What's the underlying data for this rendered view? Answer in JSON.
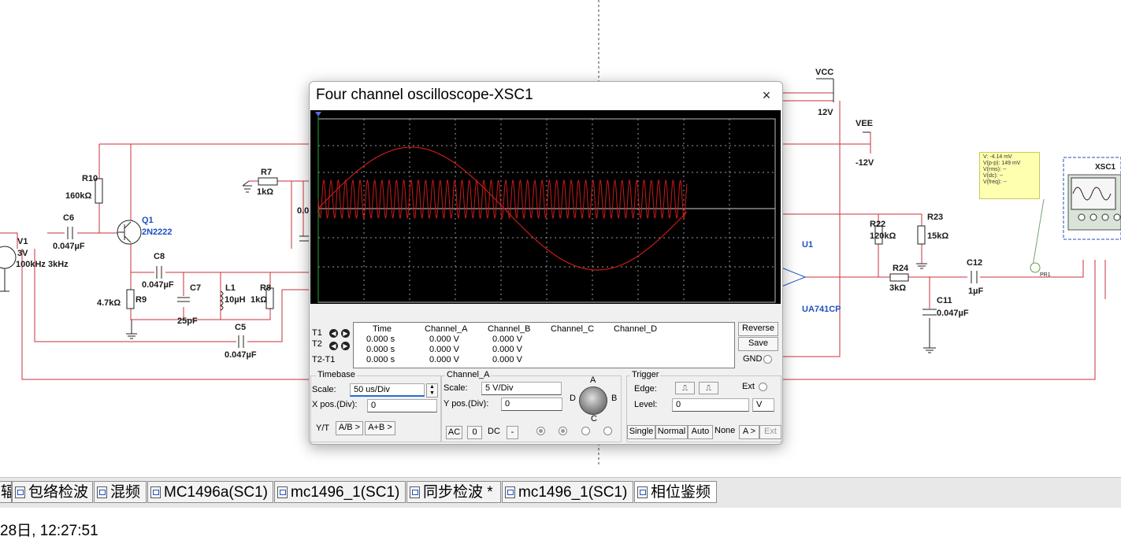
{
  "schematic": {
    "components": {
      "r10": "R10",
      "r10_val": "160kΩ",
      "c6": "C6",
      "c6_val": "0.047µF",
      "v1": "V1",
      "v1_val1": "3V",
      "v1_val2": "100kHz 3kHz",
      "q1": "Q1",
      "q1_val": "2N2222",
      "r7": "R7",
      "r7_val": "1kΩ",
      "c8": "C8",
      "c8_val": "0.047µF",
      "c7": "C7",
      "c7_val": "25pF",
      "l1": "L1",
      "l1_val": "10µH",
      "r8": "R8",
      "r8_val": "1kΩ",
      "r9": "R9",
      "r9_val": "4.7kΩ",
      "c5": "C5",
      "c5_val": "0.047µF",
      "partial_val": "0.0",
      "vcc": "VCC",
      "vcc_val": "12V",
      "vee": "VEE",
      "vee_val": "-12V",
      "u1": "U1",
      "u1_val": "UA741CP",
      "r22": "R22",
      "r22_val": "120kΩ",
      "r23": "R23",
      "r23_val": "15kΩ",
      "r24": "R24",
      "r24_val": "3kΩ",
      "c12": "C12",
      "c12_val": "1µF",
      "c11": "C11",
      "c11_val": "0.047µF",
      "pr1": "PR1",
      "xsc1": "XSC1"
    },
    "probe": [
      "V: -4.14 mV",
      "V(p-p): 149 mV",
      "V(rms): --",
      "V(dc): --",
      "V(freq): --"
    ]
  },
  "scope": {
    "title": "Four channel oscilloscope-XSC1",
    "close_icon": "×",
    "readout": {
      "headers": [
        "Time",
        "Channel_A",
        "Channel_B",
        "Channel_C",
        "Channel_D"
      ],
      "rows": [
        {
          "label": "T1",
          "time": "0.000 s",
          "a": "0.000 V",
          "b": "0.000 V"
        },
        {
          "label": "T2",
          "time": "0.000 s",
          "a": "0.000 V",
          "b": "0.000 V"
        },
        {
          "label": "T2-T1",
          "time": "0.000 s",
          "a": "0.000 V",
          "b": "0.000 V"
        }
      ]
    },
    "reverse_label": "Reverse",
    "save_label": "Save",
    "gnd_label": "GND",
    "timebase": {
      "title": "Timebase",
      "scale_label": "Scale:",
      "scale_value": "50 us/Div",
      "xpos_label": "X pos.(Div):",
      "xpos_value": "0",
      "yt_label": "Y/T",
      "ab_label": "A/B >",
      "apb_label": "A+B >"
    },
    "channel": {
      "title": "Channel_A",
      "scale_label": "Scale:",
      "scale_value": "5  V/Div",
      "ypos_label": "Y pos.(Div):",
      "ypos_value": "0",
      "ac_label": "AC",
      "zero_label": "0",
      "dc_label": "DC",
      "minus_label": "-",
      "knob": {
        "a": "A",
        "b": "B",
        "c": "C",
        "d": "D"
      }
    },
    "trigger": {
      "title": "Trigger",
      "edge_label": "Edge:",
      "ext_label": "Ext",
      "level_label": "Level:",
      "level_value": "0",
      "level_unit": "V",
      "single_label": "Single",
      "normal_label": "Normal",
      "auto_label": "Auto",
      "none_label": "None",
      "a_label": "A >",
      "ext2_label": "Ext"
    },
    "trace_color": "#cc1a1a"
  },
  "tabs": [
    {
      "label": "辐",
      "icon": "schematic-icon"
    },
    {
      "label": "包络检波",
      "icon": "schematic-icon"
    },
    {
      "label": "混频",
      "icon": "schematic-icon"
    },
    {
      "label": "MC1496a(SC1)",
      "icon": "schematic-icon"
    },
    {
      "label": "mc1496_1(SC1)",
      "icon": "schematic-icon"
    },
    {
      "label": "同步检波 *",
      "icon": "schematic-icon"
    },
    {
      "label": "mc1496_1(SC1)",
      "icon": "schematic-icon"
    },
    {
      "label": "相位鉴频",
      "icon": "schematic-icon"
    }
  ],
  "status": "28日, 12:27:51"
}
